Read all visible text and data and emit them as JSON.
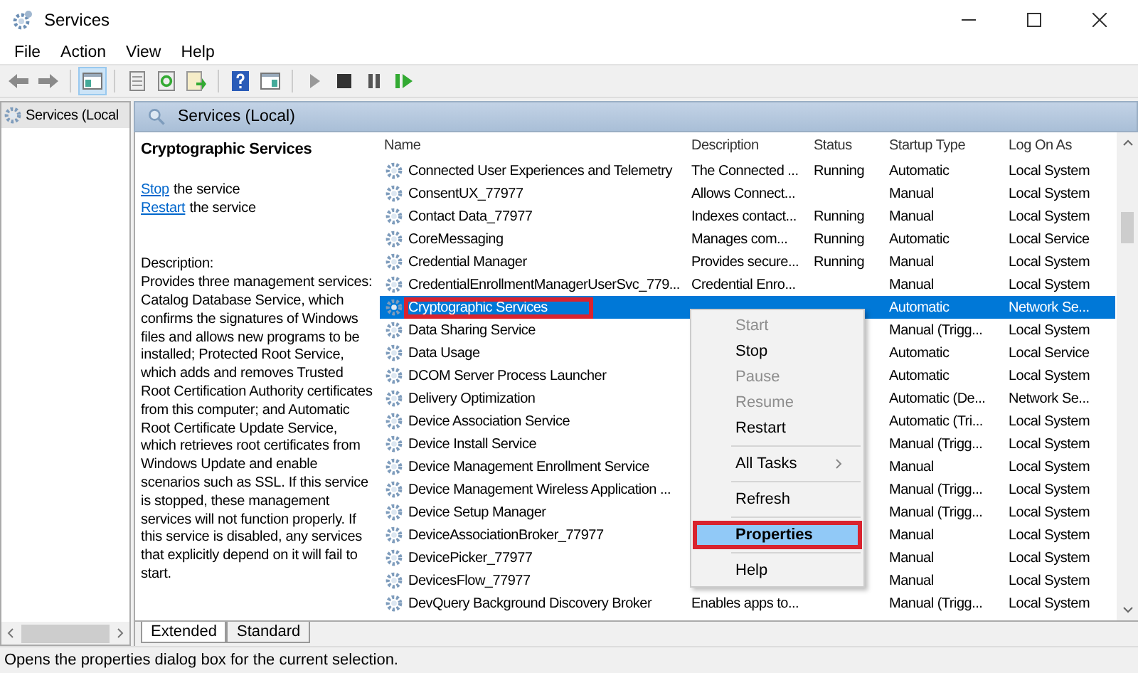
{
  "window": {
    "title": "Services"
  },
  "menu": [
    "File",
    "Action",
    "View",
    "Help"
  ],
  "tree": {
    "items": [
      {
        "label": "Services (Local",
        "selected": true
      }
    ]
  },
  "pane_header": "Services (Local)",
  "details": {
    "title": "Cryptographic Services",
    "actions": [
      {
        "link": "Stop",
        "text": "the service"
      },
      {
        "link": "Restart",
        "text": "the service"
      }
    ],
    "description_label": "Description:",
    "description": "Provides three management services: Catalog Database Service, which confirms the signatures of Windows files and allows new programs to be installed; Protected Root Service, which adds and removes Trusted Root Certification Authority certificates from this computer; and Automatic Root Certificate Update Service, which retrieves root certificates from Windows Update and enable scenarios such as SSL. If this service is stopped, these management services will not function properly. If this service is disabled, any services that explicitly depend on it will fail to start."
  },
  "table": {
    "columns": [
      "Name",
      "Description",
      "Status",
      "Startup Type",
      "Log On As"
    ],
    "rows": [
      {
        "name": "Connected User Experiences and Telemetry",
        "description": "The Connected ...",
        "status": "Running",
        "startup": "Automatic",
        "logon": "Local System",
        "selected": false,
        "annotated": false
      },
      {
        "name": "ConsentUX_77977",
        "description": "Allows Connect...",
        "status": "",
        "startup": "Manual",
        "logon": "Local System",
        "selected": false,
        "annotated": false
      },
      {
        "name": "Contact Data_77977",
        "description": "Indexes contact...",
        "status": "Running",
        "startup": "Manual",
        "logon": "Local System",
        "selected": false,
        "annotated": false
      },
      {
        "name": "CoreMessaging",
        "description": "Manages com...",
        "status": "Running",
        "startup": "Automatic",
        "logon": "Local Service",
        "selected": false,
        "annotated": false
      },
      {
        "name": "Credential Manager",
        "description": "Provides secure...",
        "status": "Running",
        "startup": "Manual",
        "logon": "Local System",
        "selected": false,
        "annotated": false
      },
      {
        "name": "CredentialEnrollmentManagerUserSvc_779...",
        "description": "Credential Enro...",
        "status": "",
        "startup": "Manual",
        "logon": "Local System",
        "selected": false,
        "annotated": false
      },
      {
        "name": "Cryptographic Services",
        "startup": "Automatic",
        "logon": "Network Se...",
        "selected": true,
        "annotated": true
      },
      {
        "name": "Data Sharing Service",
        "startup": "Manual (Trigg...",
        "logon": "Local System",
        "selected": false,
        "annotated": false
      },
      {
        "name": "Data Usage",
        "startup": "Automatic",
        "logon": "Local Service",
        "selected": false,
        "annotated": false
      },
      {
        "name": "DCOM Server Process Launcher",
        "startup": "Automatic",
        "logon": "Local System",
        "selected": false,
        "annotated": false
      },
      {
        "name": "Delivery Optimization",
        "startup": "Automatic (De...",
        "logon": "Network Se...",
        "selected": false,
        "annotated": false
      },
      {
        "name": "Device Association Service",
        "startup": "Automatic (Tri...",
        "logon": "Local System",
        "selected": false,
        "annotated": false
      },
      {
        "name": "Device Install Service",
        "startup": "Manual (Trigg...",
        "logon": "Local System",
        "selected": false,
        "annotated": false
      },
      {
        "name": "Device Management Enrollment Service",
        "startup": "Manual",
        "logon": "Local System",
        "selected": false,
        "annotated": false
      },
      {
        "name": "Device Management Wireless Application ...",
        "startup": "Manual (Trigg...",
        "logon": "Local System",
        "selected": false,
        "annotated": false
      },
      {
        "name": "Device Setup Manager",
        "startup": "Manual (Trigg...",
        "logon": "Local System",
        "selected": false,
        "annotated": false
      },
      {
        "name": "DeviceAssociationBroker_77977",
        "startup": "Manual",
        "logon": "Local System",
        "selected": false,
        "annotated": false
      },
      {
        "name": "DevicePicker_77977",
        "startup": "Manual",
        "logon": "Local System",
        "selected": false,
        "annotated": false
      },
      {
        "name": "DevicesFlow_77977",
        "startup": "Manual",
        "logon": "Local System",
        "selected": false,
        "annotated": false
      },
      {
        "name": "DevQuery Background Discovery Broker",
        "description": "Enables apps to...",
        "status": "",
        "startup": "Manual (Trigg...",
        "logon": "Local System",
        "selected": false,
        "annotated": false
      }
    ]
  },
  "context_menu": [
    {
      "kind": "item",
      "label": "Start",
      "disabled": true,
      "selected": false,
      "annotated": false
    },
    {
      "kind": "item",
      "label": "Stop",
      "disabled": false,
      "selected": false,
      "annotated": false
    },
    {
      "kind": "item",
      "label": "Pause",
      "disabled": true,
      "selected": false,
      "annotated": false
    },
    {
      "kind": "item",
      "label": "Resume",
      "disabled": true,
      "selected": false,
      "annotated": false
    },
    {
      "kind": "item",
      "label": "Restart",
      "disabled": false,
      "selected": false,
      "annotated": false
    },
    {
      "kind": "separator"
    },
    {
      "kind": "submenu",
      "label": "All Tasks",
      "disabled": false,
      "selected": false,
      "annotated": false
    },
    {
      "kind": "separator"
    },
    {
      "kind": "item",
      "label": "Refresh",
      "disabled": false,
      "selected": false,
      "annotated": false
    },
    {
      "kind": "separator"
    },
    {
      "kind": "item",
      "label": "Properties",
      "disabled": false,
      "selected": true,
      "annotated": true,
      "bold": true
    },
    {
      "kind": "separator"
    },
    {
      "kind": "item",
      "label": "Help",
      "disabled": false,
      "selected": false,
      "annotated": false
    }
  ],
  "view_tabs": [
    {
      "label": "Extended",
      "selected": true
    },
    {
      "label": "Standard",
      "selected": false
    }
  ],
  "status_bar": "Opens the properties dialog box for the current selection."
}
